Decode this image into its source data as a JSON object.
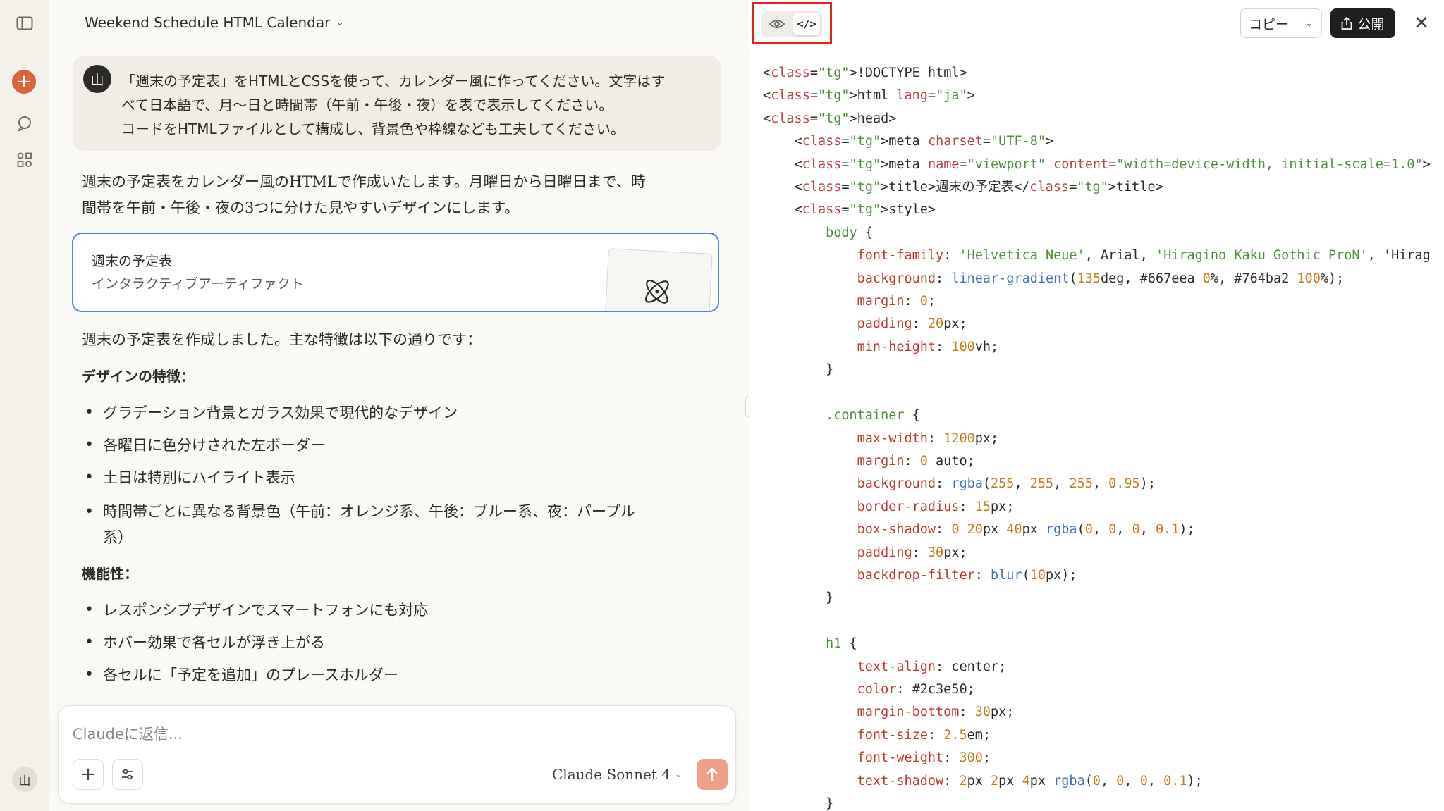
{
  "chat": {
    "title": "Weekend Schedule HTML Calendar",
    "user_avatar": "山",
    "user_message": [
      "「週末の予定表」をHTMLとCSSを使って、カレンダー風に作ってください。文字はす",
      "べて日本語で、月〜日と時間帯（午前・午後・夜）を表で表示してください。",
      "コードをHTMLファイルとして構成し、背景色や枠線なども工夫してください。"
    ],
    "response_intro": [
      "週末の予定表をカレンダー風のHTMLで作成いたします。月曜日から日曜日まで、時",
      "間帯を午前・午後・夜の3つに分けた見やすいデザインにします。"
    ],
    "artifact": {
      "title": "週末の予定表",
      "subtitle": "インタラクティブアーティファクト"
    },
    "summary": "週末の予定表を作成しました。主な特徴は以下の通りです：",
    "design_heading": "デザインの特徴：",
    "design_items": [
      "グラデーション背景とガラス効果で現代的なデザイン",
      "各曜日に色分けされた左ボーダー",
      "土日は特別にハイライト表示",
      "時間帯ごとに異なる背景色（午前：オレンジ系、午後：ブルー系、夜：パープル",
      "系）"
    ],
    "func_heading": "機能性：",
    "func_items": [
      "レスポンシブデザインでスマートフォンにも対応",
      "ホバー効果で各セルが浮き上がる",
      "各セルに「予定を追加」のプレースホルダー"
    ]
  },
  "composer": {
    "placeholder": "Claudeに返信...",
    "model": "Claude Sonnet 4"
  },
  "sidebar": {
    "user_initial": "山"
  },
  "panel": {
    "copy_label": "コピー",
    "publish_label": "公開",
    "code_toggle_label": "</>",
    "code_lines": [
      "<!DOCTYPE html>",
      "<html lang=\"ja\">",
      "<head>",
      "    <meta charset=\"UTF-8\">",
      "    <meta name=\"viewport\" content=\"width=device-width, initial-scale=1.0\">",
      "    <title>週末の予定表</title>",
      "    <style>",
      "        body {",
      "            font-family: 'Helvetica Neue', Arial, 'Hiragino Kaku Gothic ProN', 'Hirag",
      "            background: linear-gradient(135deg, #667eea 0%, #764ba2 100%);",
      "            margin: 0;",
      "            padding: 20px;",
      "            min-height: 100vh;",
      "        }",
      "",
      "        .container {",
      "            max-width: 1200px;",
      "            margin: 0 auto;",
      "            background: rgba(255, 255, 255, 0.95);",
      "            border-radius: 15px;",
      "            box-shadow: 0 20px 40px rgba(0, 0, 0, 0.1);",
      "            padding: 30px;",
      "            backdrop-filter: blur(10px);",
      "        }",
      "",
      "        h1 {",
      "            text-align: center;",
      "            color: #2c3e50;",
      "            margin-bottom: 30px;",
      "            font-size: 2.5em;",
      "            font-weight: 300;",
      "            text-shadow: 2px 2px 4px rgba(0, 0, 0, 0.1);",
      "        }"
    ]
  },
  "colors": {
    "accent_orange": "#d9643a",
    "artifact_border": "#4a82e0",
    "highlight_red": "#e2241f",
    "send_button": "#ee9f87"
  }
}
